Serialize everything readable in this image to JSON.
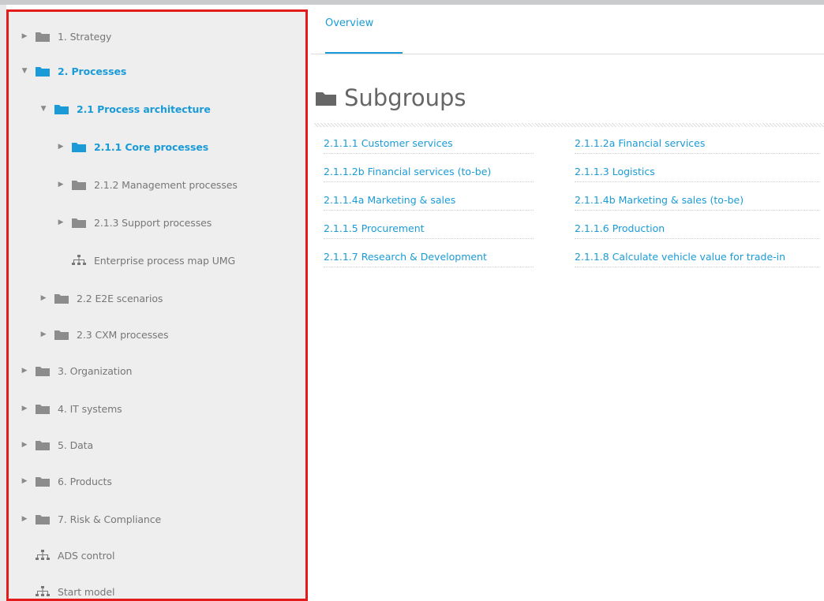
{
  "sidebar": {
    "items": [
      {
        "label": "1. Strategy",
        "icon": "folder-icon",
        "expanded": false
      },
      {
        "label": "2. Processes",
        "icon": "folder-icon",
        "expanded": true
      },
      {
        "label": "2.1 Process architecture",
        "icon": "folder-icon",
        "expanded": true
      },
      {
        "label": "2.1.1 Core processes",
        "icon": "folder-icon",
        "expanded": false
      },
      {
        "label": "2.1.2 Management processes",
        "icon": "folder-icon",
        "expanded": false
      },
      {
        "label": "2.1.3 Support processes",
        "icon": "folder-icon",
        "expanded": false
      },
      {
        "label": "Enterprise process map UMG",
        "icon": "model-icon"
      },
      {
        "label": "2.2 E2E scenarios",
        "icon": "folder-icon",
        "expanded": false
      },
      {
        "label": "2.3 CXM processes",
        "icon": "folder-icon",
        "expanded": false
      },
      {
        "label": "3. Organization",
        "icon": "folder-icon",
        "expanded": false
      },
      {
        "label": "4. IT systems",
        "icon": "folder-icon",
        "expanded": false
      },
      {
        "label": "5. Data",
        "icon": "folder-icon",
        "expanded": false
      },
      {
        "label": "6. Products",
        "icon": "folder-icon",
        "expanded": false
      },
      {
        "label": "7. Risk & Compliance",
        "icon": "folder-icon",
        "expanded": false
      },
      {
        "label": "ADS control",
        "icon": "model-icon"
      },
      {
        "label": "Start model",
        "icon": "model-icon"
      }
    ]
  },
  "tabs": {
    "overview": "Overview"
  },
  "main": {
    "heading": "Subgroups",
    "subgroups": [
      "2.1.1.1 Customer services",
      "2.1.1.2a Financial services",
      "2.1.1.2b Financial services (to-be)",
      "2.1.1.3 Logistics",
      "2.1.1.4a Marketing & sales",
      "2.1.1.4b Marketing & sales (to-be)",
      "2.1.1.5 Procurement",
      "2.1.1.6 Production",
      "2.1.1.7 Research & Development",
      "2.1.1.8 Calculate vehicle value for trade-in"
    ]
  },
  "colors": {
    "accent": "#1a9bd7",
    "highlight_border": "#e31b1b",
    "sidebar_bg": "#eeeeee"
  }
}
